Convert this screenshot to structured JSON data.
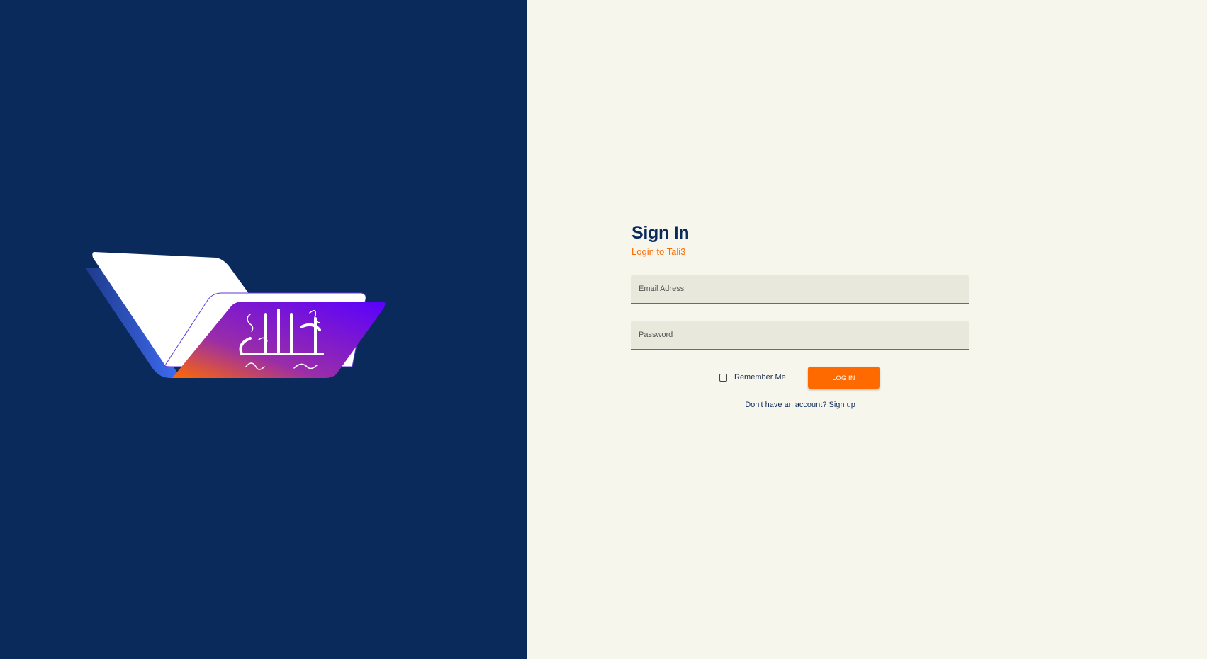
{
  "brand": {
    "logo_icon": "folder-calligraphy-logo-icon",
    "background_color": "#0a2a5c",
    "accent_color": "#ff6a00"
  },
  "signin": {
    "title": "Sign In",
    "subtitle": "Login to Tali3",
    "email_placeholder": "Email Adress",
    "email_value": "",
    "password_placeholder": "Password",
    "password_value": "",
    "remember_label": "Remember Me",
    "remember_checked": false,
    "login_label": "LOG IN",
    "signup_prompt": "Don't have an account?",
    "signup_link": "Sign up"
  }
}
